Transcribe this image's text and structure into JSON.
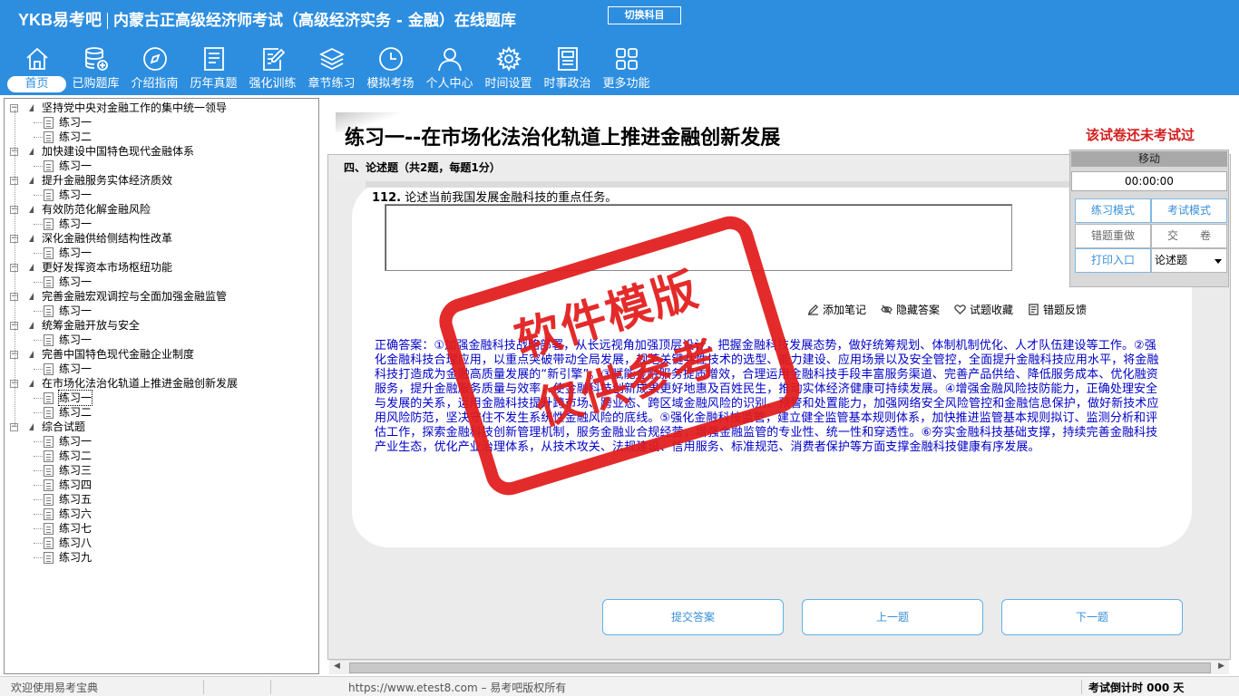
{
  "header": {
    "brand": "YKB易考吧",
    "app_title": "内蒙古正高级经济师考试（高级经济实务 - 金融）在线题库",
    "switch_subject": "切换科目"
  },
  "nav": [
    {
      "label": "首页",
      "icon": "home-icon"
    },
    {
      "label": "已购题库",
      "icon": "database-icon"
    },
    {
      "label": "介绍指南",
      "icon": "compass-icon"
    },
    {
      "label": "历年真题",
      "icon": "document-list-icon"
    },
    {
      "label": "强化训练",
      "icon": "edit-icon"
    },
    {
      "label": "章节练习",
      "icon": "layers-icon"
    },
    {
      "label": "模拟考场",
      "icon": "clock-icon"
    },
    {
      "label": "个人中心",
      "icon": "user-icon"
    },
    {
      "label": "时间设置",
      "icon": "gear-icon"
    },
    {
      "label": "时事政治",
      "icon": "newspaper-icon"
    },
    {
      "label": "更多功能",
      "icon": "grid-icon"
    }
  ],
  "tree": [
    {
      "label": "坚持党中央对金融工作的集中统一领导",
      "children": [
        "练习一",
        "练习二"
      ]
    },
    {
      "label": "加快建设中国特色现代金融体系",
      "children": [
        "练习一"
      ]
    },
    {
      "label": "提升金融服务实体经济质效",
      "children": [
        "练习一"
      ]
    },
    {
      "label": "有效防范化解金融风险",
      "children": [
        "练习一"
      ]
    },
    {
      "label": "深化金融供给侧结构性改革",
      "children": [
        "练习一"
      ]
    },
    {
      "label": "更好发挥资本市场枢纽功能",
      "children": [
        "练习一"
      ]
    },
    {
      "label": "完善金融宏观调控与全面加强金融监管",
      "children": [
        "练习一"
      ]
    },
    {
      "label": "统筹金融开放与安全",
      "children": [
        "练习一"
      ]
    },
    {
      "label": "完善中国特色现代金融企业制度",
      "children": [
        "练习一"
      ]
    },
    {
      "label": "在市场化法治化轨道上推进金融创新发展",
      "children": [
        "练习一",
        "练习二"
      ]
    },
    {
      "label": "综合试题",
      "children": [
        "练习一",
        "练习二",
        "练习三",
        "练习四",
        "练习五",
        "练习六",
        "练习七",
        "练习八",
        "练习九"
      ]
    }
  ],
  "paper": {
    "title": "练习一--在市场化法治化轨道上推进金融创新发展",
    "status": "该试卷还未考试过",
    "section": "四、论述题（共2题，每题1分）",
    "question_number": "112.",
    "question_text": "论述当前我国发展金融科技的重点任务。",
    "answer_value": "",
    "correct_answer": "正确答案：①加强金融科技战略部署，从长远视角加强顶层设计，把握金融科技发展态势，做好统筹规划、体制机制优化、人才队伍建设等工作。②强化金融科技合理应用，以重点突破带动全局发展，规范关键共性技术的选型、能力建设、应用场景以及安全管控，全面提升金融科技应用水平，将金融科技打造成为金融高质量发展的“新引擎”。③赋能金融服务提质增效，合理运用金融科技手段丰富服务渠道、完善产品供给、降低服务成本、优化融资服务，提升金融服务质量与效率，使金融科技创新成果更好地惠及百姓民生，推动实体经济健康可持续发展。④增强金融风险技防能力，正确处理安全与发展的关系，运用金融科技提升跨市场、跨业态、跨区域金融风险的识别、预警和处置能力，加强网络安全风险管控和金融信息保护，做好新技术应用风险防范，坚决守住不发生系统性金融风险的底线。⑤强化金融科技监管，建立健全监管基本规则体系，加快推进监管基本规则拟订、监测分析和评估工作，探索金融科技创新管理机制，服务金融业合规经营，增强金融监管的专业性、统一性和穿透性。⑥夯实金融科技基础支撑，持续完善金融科技产业生态，优化产业治理体系，从技术攻关、法规建设、信用服务、标准规范、消费者保护等方面支撑金融科技健康有序发展。"
  },
  "tools": {
    "note": "添加笔记",
    "hide_answer": "隐藏答案",
    "favorite": "试题收藏",
    "feedback": "错题反馈"
  },
  "buttons": {
    "submit": "提交答案",
    "prev": "上一题",
    "next": "下一题"
  },
  "right_panel": {
    "move": "移动",
    "timer": "00:00:00",
    "practice_mode": "练习模式",
    "exam_mode": "考试模式",
    "redo_wrong": "错题重做",
    "hand_in": "交　　卷",
    "print": "打印入口",
    "type_select": "论述题"
  },
  "status": {
    "welcome": "欢迎使用易考宝典",
    "copyright": "https://www.etest8.com – 易考吧版权所有",
    "countdown": "考试倒计时 000 天"
  },
  "watermark": {
    "line1": "软件模版",
    "line2": "仅供参考"
  },
  "colors": {
    "header_bg": "#2d8ee0",
    "accent_red": "#d21f1f",
    "answer_blue": "#0000c8"
  }
}
